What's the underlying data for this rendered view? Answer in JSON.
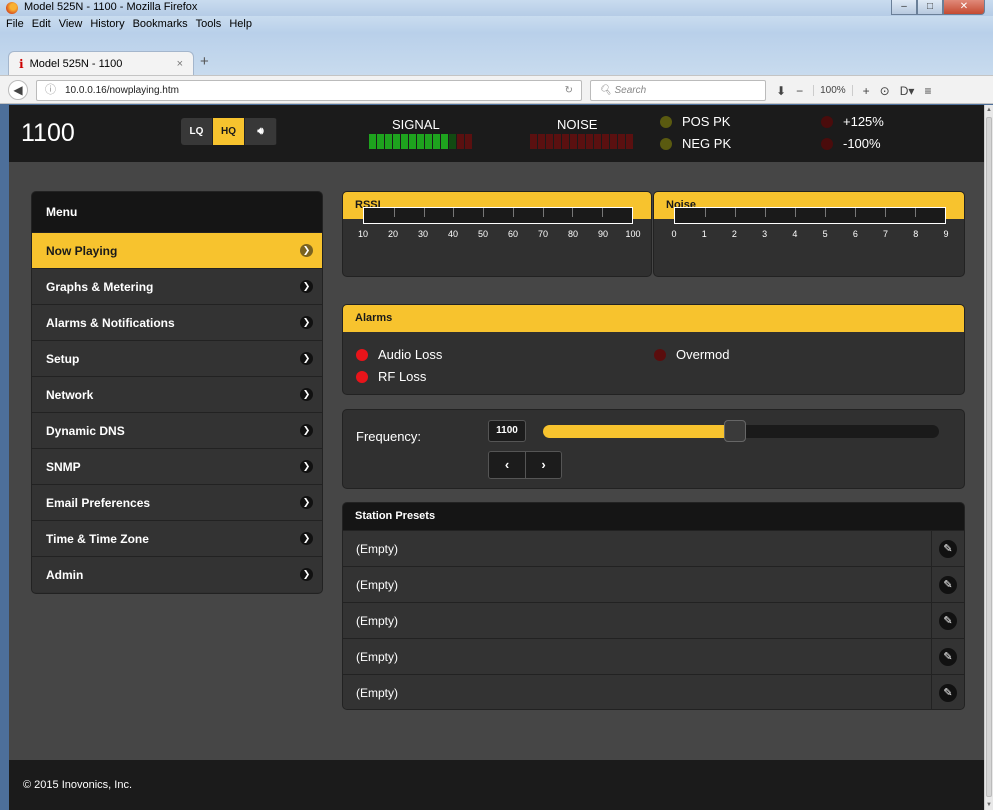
{
  "window": {
    "title": "Model 525N - 1100 - Mozilla Firefox",
    "min": "‒",
    "max": "□",
    "close": "✕"
  },
  "menubar": [
    "File",
    "Edit",
    "View",
    "History",
    "Bookmarks",
    "Tools",
    "Help"
  ],
  "tab": {
    "title": "Model 525N - 1100",
    "close": "×",
    "new": "+"
  },
  "navbar": {
    "url": "10.0.0.16/nowplaying.htm",
    "search_placeholder": "Search",
    "zoom": "100%"
  },
  "header": {
    "station": "1100",
    "quality": [
      "LQ",
      "HQ"
    ],
    "quality_selected": "HQ",
    "signal_label": "SIGNAL",
    "noise_label": "NOISE",
    "signal_level": 0.8,
    "noise_level": 0,
    "pos_pk": "POS PK",
    "neg_pk": "NEG PK",
    "pos_pct": "+125%",
    "neg_pct": "-100%"
  },
  "menu": {
    "title": "Menu",
    "items": [
      "Now Playing",
      "Graphs & Metering",
      "Alarms & Notifications",
      "Setup",
      "Network",
      "Dynamic DNS",
      "SNMP",
      "Email Preferences",
      "Time & Time Zone",
      "Admin"
    ],
    "active_index": 0
  },
  "rssi": {
    "title": "RSSI",
    "ticks": [
      "10",
      "20",
      "30",
      "40",
      "50",
      "60",
      "70",
      "80",
      "90",
      "100"
    ]
  },
  "noise": {
    "title": "Noise",
    "ticks": [
      "0",
      "1",
      "2",
      "3",
      "4",
      "5",
      "6",
      "7",
      "8",
      "9"
    ]
  },
  "alarms": {
    "title": "Alarms",
    "audio_loss": "Audio Loss",
    "rf_loss": "RF Loss",
    "overmod": "Overmod"
  },
  "frequency": {
    "label": "Frequency:",
    "value": "1100",
    "slider_fraction": 0.485,
    "prev": "‹",
    "next": "›"
  },
  "presets": {
    "title": "Station Presets",
    "items": [
      "(Empty)",
      "(Empty)",
      "(Empty)",
      "(Empty)",
      "(Empty)"
    ]
  },
  "footer": {
    "copyright": "© 2015 Inovonics, Inc."
  },
  "colors": {
    "accent": "#f7c32e",
    "alarm_on": "#e8141a",
    "alarm_off": "#5a0d0d",
    "pk_off": "#5a5a10"
  }
}
